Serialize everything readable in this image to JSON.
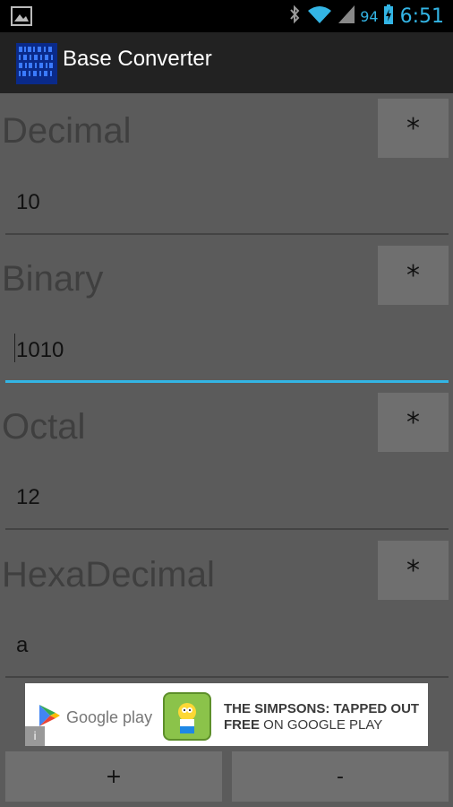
{
  "status_bar": {
    "battery_percent": "94",
    "time": "6:51"
  },
  "action_bar": {
    "title": "Base Converter"
  },
  "fields": [
    {
      "label": "Decimal",
      "button": "*",
      "value": "10"
    },
    {
      "label": "Binary",
      "button": "*",
      "value": "1010"
    },
    {
      "label": "Octal",
      "button": "*",
      "value": "12"
    },
    {
      "label": "HexaDecimal",
      "button": "*",
      "value": "a"
    }
  ],
  "ad": {
    "store_label": "Google play",
    "headline": "THE SIMPSONS: TAPPED OUT",
    "sub_bold": "FREE",
    "sub_rest": " ON GOOGLE PLAY",
    "info_glyph": "i"
  },
  "buttons": {
    "plus": "+",
    "minus": "-"
  },
  "colors": {
    "accent": "#33b5e5",
    "background": "#5b5b5b",
    "action_bar": "#222222"
  }
}
